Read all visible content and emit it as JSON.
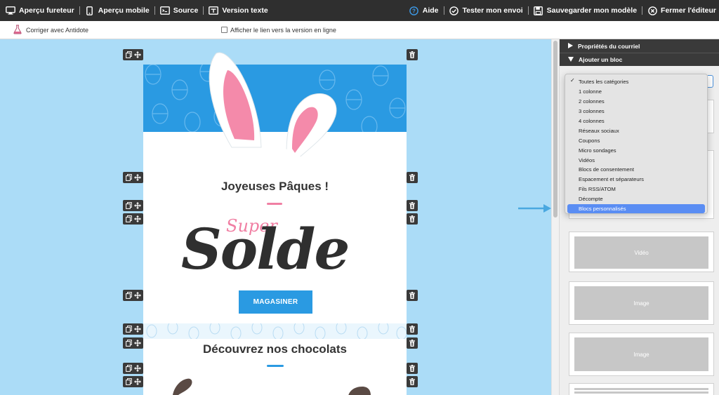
{
  "toolbar": {
    "left": [
      {
        "label": "Aperçu fureteur",
        "icon": "monitor-icon"
      },
      {
        "label": "Aperçu mobile",
        "icon": "mobile-icon"
      },
      {
        "label": "Source",
        "icon": "source-icon"
      },
      {
        "label": "Version texte",
        "icon": "text-version-icon"
      }
    ],
    "right": [
      {
        "label": "Aide",
        "icon": "help-icon"
      },
      {
        "label": "Tester mon envoi",
        "icon": "check-circle-icon"
      },
      {
        "label": "Sauvegarder mon modèle",
        "icon": "save-icon"
      },
      {
        "label": "Fermer l'éditeur",
        "icon": "close-circle-icon"
      }
    ]
  },
  "subbar": {
    "antidote_label": "Corriger avec Antidote",
    "online_link_label": "Afficher le lien vers la version en ligne",
    "online_link_checked": false
  },
  "email": {
    "title_1": "Joyeuses Pâques !",
    "super_text": "Super",
    "solde_text": "Solde",
    "cta_label": "MAGASINER",
    "title_2": "Découvrez nos chocolats",
    "pink": "#f07fa3",
    "blue": "#2a9ae2"
  },
  "panel": {
    "section_email_props": "Propriétés du courriel",
    "section_add_block": "Ajouter un bloc",
    "dropdown": {
      "options": [
        "Toutes les catégories",
        "1 colonne",
        "2 colonnes",
        "3 colonnes",
        "4 colonnes",
        "Réseaux sociaux",
        "Coupons",
        "Micro sondages",
        "Vidéos",
        "Blocs de consentement",
        "Espacement et séparateurs",
        "Fils RSS/ATOM",
        "Décompte",
        "Blocs personnalisés"
      ],
      "checked": "Toutes les catégories",
      "selected": "Blocs personnalisés",
      "highlight_color": "#5a8df3"
    },
    "tiles": {
      "video": "Vidéo",
      "image_1": "Image",
      "image_2": "Image"
    }
  }
}
